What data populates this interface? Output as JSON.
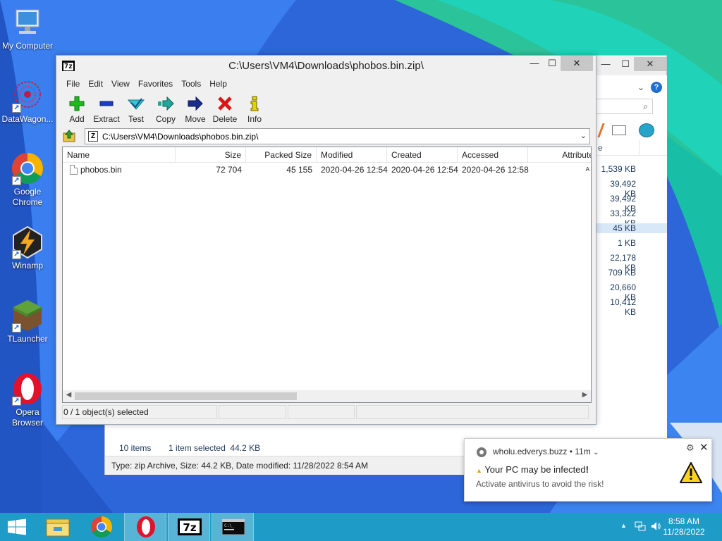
{
  "desktop": {
    "icons": [
      {
        "label": "My Computer"
      },
      {
        "label": "DataWagon..."
      },
      {
        "label": "Google Chrome"
      },
      {
        "label": "Winamp"
      },
      {
        "label": "TLauncher"
      },
      {
        "label": "Opera Browser"
      }
    ]
  },
  "explorer": {
    "header_partial": "e",
    "sizes": [
      "1,539 KB",
      "39,492 KB",
      "39,492 KB",
      "33,322 KB",
      "45 KB",
      "1 KB",
      "22,178 KB",
      "709 KB",
      "20,660 KB",
      "10,412 KB"
    ],
    "selected_index": 4,
    "status_items": "10 items",
    "status_selected": "1 item selected  44.2 KB",
    "details": "Type: zip Archive, Size: 44.2 KB, Date modified: 11/28/2022 8:54 AM",
    "minimize": "—",
    "maximize": "☐",
    "close": "✕"
  },
  "sevenzip": {
    "app_icon": "7z",
    "title": "C:\\Users\\VM4\\Downloads\\phobos.bin.zip\\",
    "minimize": "—",
    "maximize": "☐",
    "close": "✕",
    "menu": [
      "File",
      "Edit",
      "View",
      "Favorites",
      "Tools",
      "Help"
    ],
    "toolbar": {
      "add": "Add",
      "extract": "Extract",
      "test": "Test",
      "copy": "Copy",
      "move": "Move",
      "delete": "Delete",
      "info": "Info"
    },
    "address": "C:\\Users\\VM4\\Downloads\\phobos.bin.zip\\",
    "columns": {
      "name": "Name",
      "size": "Size",
      "packed": "Packed Size",
      "modified": "Modified",
      "created": "Created",
      "accessed": "Accessed",
      "attributes": "Attribute"
    },
    "files": [
      {
        "name": "phobos.bin",
        "size": "72 704",
        "packed": "45 155",
        "modified": "2020-04-26 12:54",
        "created": "2020-04-26 12:54",
        "accessed": "2020-04-26 12:58",
        "attributes": "A"
      }
    ],
    "status": "0 / 1 object(s) selected"
  },
  "notification": {
    "site": "wholu.edverys.buzz",
    "age": "• 11m",
    "title": "Your PC may be infected",
    "exclaim": "!",
    "body": "Activate antivirus to avoid the risk!"
  },
  "taskbar": {
    "time": "8:58 AM",
    "date": "11/28/2022"
  },
  "colors": {
    "taskbar": "#1f9bc8",
    "selection": "#d9e8f9",
    "close_button": "#c7c7c7"
  }
}
